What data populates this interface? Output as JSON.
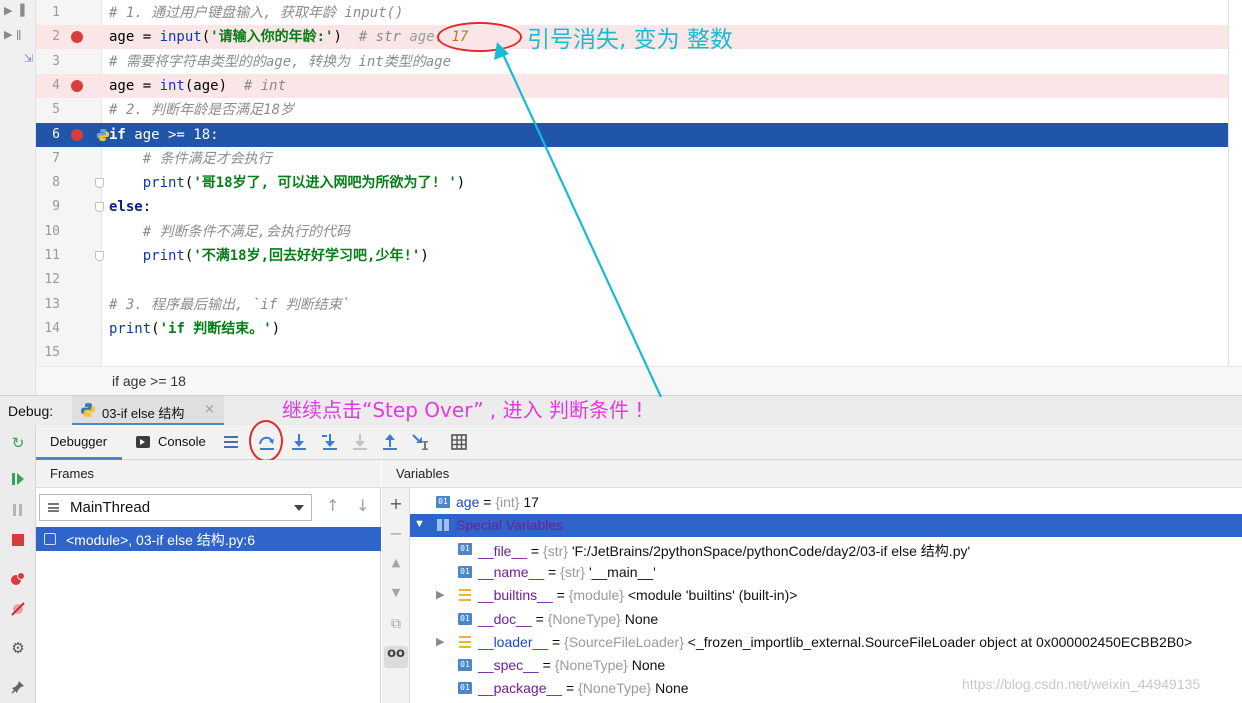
{
  "editor": {
    "lines": [
      {
        "num": "1",
        "tokens": [
          {
            "t": "# 1. 通过用户键盘输入, 获取年龄 input()",
            "c": "c"
          }
        ]
      },
      {
        "num": "2",
        "breakpoint": true,
        "tokens": [
          {
            "t": "age = ",
            "c": ""
          },
          {
            "t": "input",
            "c": "b"
          },
          {
            "t": "(",
            "c": ""
          },
          {
            "t": "'请输入你的年龄:'",
            "c": "s"
          },
          {
            "t": ")  ",
            "c": ""
          },
          {
            "t": "# str ",
            "c": "c"
          }
        ],
        "inline_hint": {
          "label": "age: ",
          "value": "17"
        }
      },
      {
        "num": "3",
        "tokens": [
          {
            "t": "# 需要将字符串类型的的age, 转换为 int类型的age",
            "c": "c"
          }
        ]
      },
      {
        "num": "4",
        "breakpoint": true,
        "tokens": [
          {
            "t": "age = ",
            "c": ""
          },
          {
            "t": "int",
            "c": "b"
          },
          {
            "t": "(age)  ",
            "c": ""
          },
          {
            "t": "# int",
            "c": "c"
          }
        ]
      },
      {
        "num": "5",
        "tokens": [
          {
            "t": "# 2. 判断年龄是否满足18岁",
            "c": "c"
          }
        ]
      },
      {
        "num": "6",
        "breakpoint": true,
        "current": true,
        "tokens": [
          {
            "t": "if",
            "c": "k"
          },
          {
            "t": " age >= 18:",
            "c": ""
          }
        ]
      },
      {
        "num": "7",
        "tokens": [
          {
            "t": "    # 条件满足才会执行",
            "c": "c"
          }
        ]
      },
      {
        "num": "8",
        "tokens": [
          {
            "t": "    ",
            "c": ""
          },
          {
            "t": "print",
            "c": "b"
          },
          {
            "t": "(",
            "c": ""
          },
          {
            "t": "'哥18岁了, 可以进入网吧为所欲为了! '",
            "c": "s"
          },
          {
            "t": ")",
            "c": ""
          }
        ]
      },
      {
        "num": "9",
        "tokens": [
          {
            "t": "else",
            "c": "k"
          },
          {
            "t": ":",
            "c": ""
          }
        ]
      },
      {
        "num": "10",
        "tokens": [
          {
            "t": "    # 判断条件不满足,会执行的代码",
            "c": "c"
          }
        ]
      },
      {
        "num": "11",
        "tokens": [
          {
            "t": "    ",
            "c": ""
          },
          {
            "t": "print",
            "c": "b"
          },
          {
            "t": "(",
            "c": ""
          },
          {
            "t": "'不满18岁,回去好好学习吧,少年!'",
            "c": "s"
          },
          {
            "t": ")",
            "c": ""
          }
        ]
      },
      {
        "num": "12",
        "tokens": []
      },
      {
        "num": "13",
        "tokens": [
          {
            "t": "# 3. 程序最后输出, `if 判断结束`",
            "c": "c"
          }
        ]
      },
      {
        "num": "14",
        "tokens": [
          {
            "t": "print",
            "c": "b"
          },
          {
            "t": "(",
            "c": ""
          },
          {
            "t": "'if 判断结束。'",
            "c": "s"
          },
          {
            "t": ")",
            "c": ""
          }
        ]
      },
      {
        "num": "15",
        "tokens": []
      }
    ],
    "breadcrumb": "if age >= 18"
  },
  "annotations": {
    "top": "引号消失, 变为 整数",
    "debug": "继续点击“Step Over” , 进入 判断条件 !"
  },
  "debug": {
    "label": "Debug:",
    "tab_title": "03-if else 结构",
    "tab_close": "×",
    "debugger_tab": "Debugger",
    "console_tab": "Console",
    "toolbar_icons": [
      "show-execution-point-icon",
      "step-over-icon",
      "step-into-icon",
      "step-into-my-code-icon",
      "force-step-into-icon",
      "step-out-icon",
      "run-to-cursor-icon",
      "evaluate-expression-icon"
    ],
    "side_icons": [
      "rerun-icon",
      "resume-icon",
      "pause-icon",
      "stop-icon",
      "view-breakpoints-icon",
      "mute-breakpoints-icon",
      "settings-icon",
      "pin-icon"
    ]
  },
  "frames": {
    "header": "Frames",
    "thread": "MainThread",
    "selected_frame": "<module>, 03-if else 结构.py:6"
  },
  "variables": {
    "header": "Variables",
    "rows": [
      {
        "indent": 0,
        "icon": "int",
        "name": "age",
        "name_color": "blue",
        "type": "{int}",
        "value": "17"
      },
      {
        "indent": 0,
        "icon": "grid",
        "name": "Special Variables",
        "expanded": true,
        "selected": true,
        "type": "",
        "value": ""
      },
      {
        "indent": 1,
        "icon": "int",
        "name": "__file__",
        "type": "{str}",
        "value": "'F:/JetBrains/2pythonSpace/pythonCode/day2/03-if else 结构.py'"
      },
      {
        "indent": 1,
        "icon": "int",
        "name": "__name__",
        "type": "{str}",
        "value": "'__main__'"
      },
      {
        "indent": 1,
        "icon": "mod",
        "name": "__builtins__",
        "collapsed": true,
        "type": "{module}",
        "value": "<module 'builtins' (built-in)>"
      },
      {
        "indent": 1,
        "icon": "int",
        "name": "__doc__",
        "type": "{NoneType}",
        "value": "None"
      },
      {
        "indent": 1,
        "icon": "mod",
        "name": "__loader__",
        "collapsed": true,
        "name_color": "blue",
        "type": "{SourceFileLoader}",
        "value": "<_frozen_importlib_external.SourceFileLoader object at 0x000002450ECBB2B0>"
      },
      {
        "indent": 1,
        "icon": "int",
        "name": "__spec__",
        "type": "{NoneType}",
        "value": "None"
      },
      {
        "indent": 1,
        "icon": "int",
        "name": "__package__",
        "type": "{NoneType}",
        "value": "None"
      }
    ]
  },
  "watermark": "https://blog.csdn.net/weixin_44949135",
  "colors": {
    "current_line": "#2155a9",
    "breakpoint_line": "#fae6e6",
    "breakpoint_dot": "#d93e3e",
    "annotation_cyan": "#17bcd4",
    "annotation_magenta": "#e23ae2",
    "highlight_circle": "#e02a2a",
    "selection": "#2f65ca"
  }
}
